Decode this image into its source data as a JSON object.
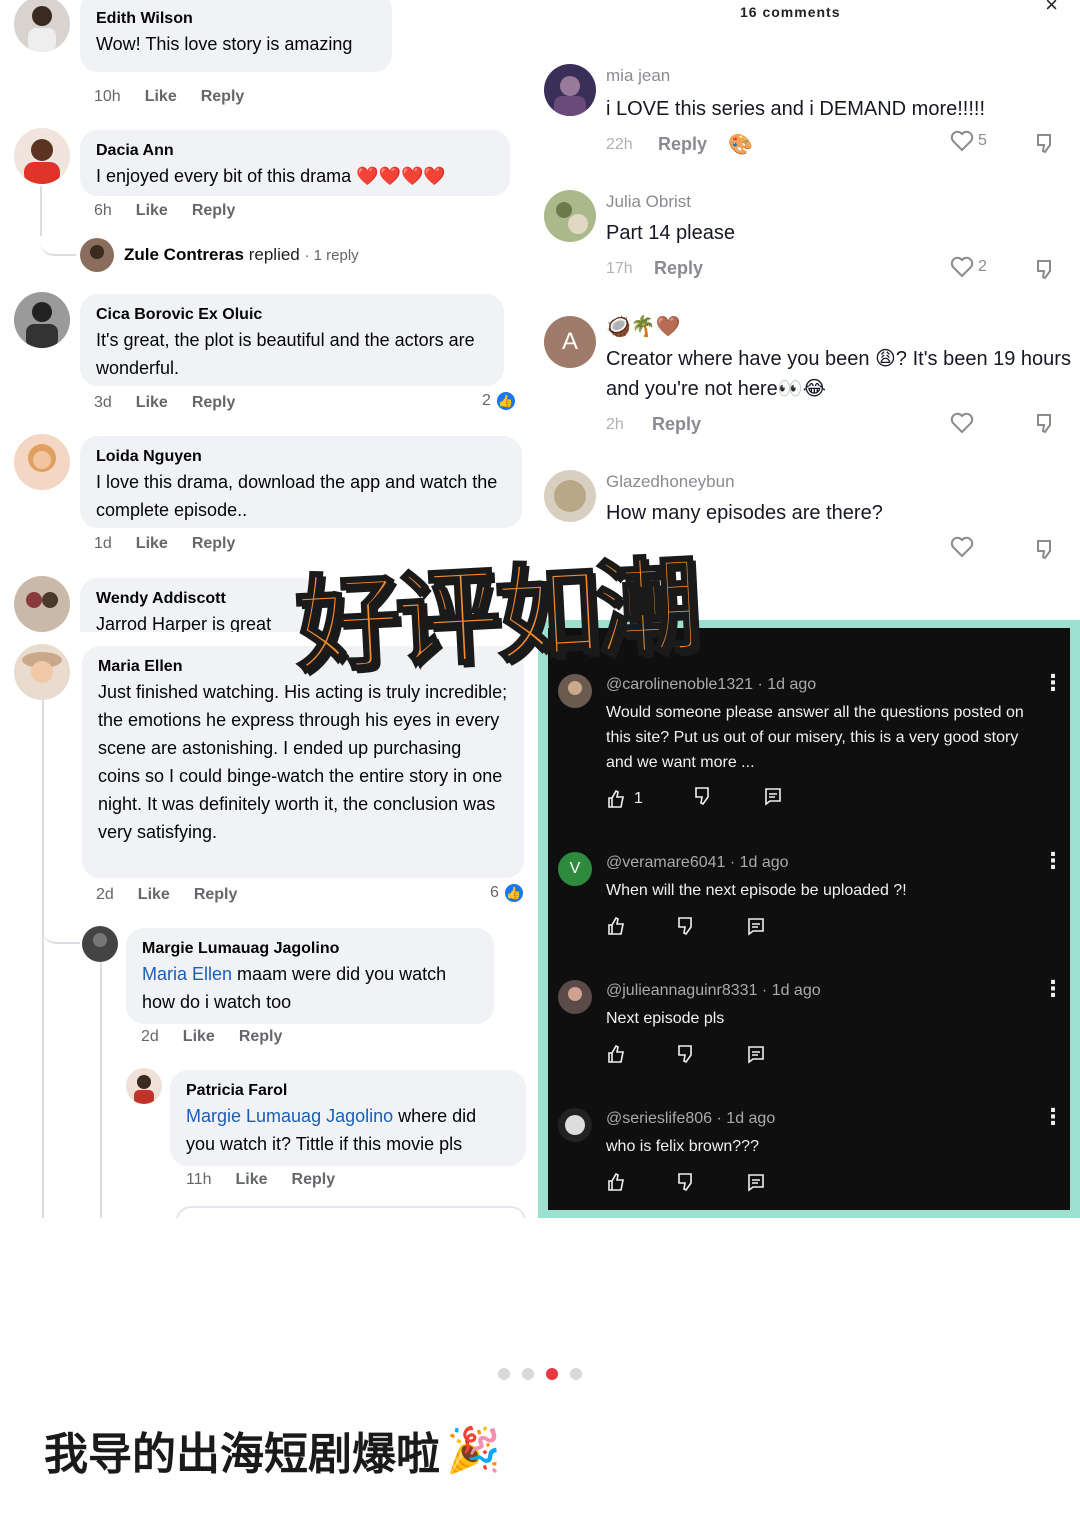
{
  "facebook": {
    "edith": {
      "name": "Edith Wilson",
      "text": "Wow! This love story is amazing",
      "time": "10h",
      "like": "Like",
      "reply": "Reply"
    },
    "dacia": {
      "name": "Dacia Ann",
      "text": "I enjoyed every bit of this drama",
      "emoji": "❤️❤️❤️❤️",
      "time": "6h",
      "like": "Like",
      "reply": "Reply",
      "replied": {
        "name": "Zule Contreras",
        "verb": "replied",
        "count": "· 1 reply"
      }
    },
    "cica": {
      "name": "Cica Borovic Ex Oluic",
      "text": "It's great, the plot is beautiful and the actors are wonderful.",
      "time": "3d",
      "like": "Like",
      "reply": "Reply",
      "reactions": "2"
    },
    "loida": {
      "name": "Loida Nguyen",
      "text": "I love this drama, download the app and watch the complete episode..",
      "time": "1d",
      "like": "Like",
      "reply": "Reply"
    },
    "wendy": {
      "name": "Wendy Addiscott",
      "text": "Jarrod Harper is great"
    },
    "maria": {
      "name": "Maria Ellen",
      "text": "Just finished watching. His acting is truly incredible; the emotions he express through his eyes in every scene are astonishing. I ended up purchasing coins so I could binge-watch the entire story in one night. It was definitely worth it, the conclusion was very satisfying.",
      "time": "2d",
      "like": "Like",
      "reply": "Reply",
      "reactions": "6"
    },
    "margie": {
      "name": "Margie Lumauag Jagolino",
      "mention": "Maria Ellen",
      "text": " maam were did you watch how do i watch too",
      "time": "2d",
      "like": "Like",
      "reply": "Reply"
    },
    "patricia": {
      "name": "Patricia Farol",
      "mention": "Margie Lumauag Jagolino",
      "text": " where did you watch it? Tittle if this movie pls",
      "time": "11h",
      "like": "Like",
      "reply": "Reply"
    }
  },
  "tiktok": {
    "header": "16 comments",
    "close": "×",
    "comments": [
      {
        "name": "mia jean",
        "text": "i LOVE this series and i DEMAND more!!!!!",
        "time": "22h",
        "reply": "Reply",
        "likes": "5",
        "extra": "🎨"
      },
      {
        "name": "Julia Obrist",
        "text": "Part 14 please",
        "time": "17h",
        "reply": "Reply",
        "likes": "2"
      },
      {
        "name": "🥥🌴🤎",
        "text": "Creator where have you been 😩? It's been 19 hours and you're not here👀😂",
        "time": "2h",
        "reply": "Reply",
        "likes": "",
        "avatar_letter": "A"
      },
      {
        "name": "Glazedhoneybun",
        "text": "How many episodes are there?",
        "time": "",
        "reply": "",
        "likes": ""
      }
    ]
  },
  "youtube": {
    "comments": [
      {
        "handle": "@carolinenoble1321 · 1d ago",
        "text": "Would someone please answer all the questions posted on this site? Put us out of our misery, this is a very good story and we want more ...",
        "likes": "1"
      },
      {
        "handle": "@veramare6041 · 1d ago",
        "text": "When will the next episode be uploaded ?!",
        "likes": "",
        "avatar_letter": "V"
      },
      {
        "handle": "@julieannaguinr8331 · 1d ago",
        "text": "Next episode pls",
        "likes": ""
      },
      {
        "handle": "@serieslife806 · 1d ago",
        "text": "who is felix brown???",
        "likes": ""
      }
    ]
  },
  "overlay_title": "好评如潮",
  "caption": {
    "text": "我导的出海短剧爆啦",
    "emoji": "🎉"
  },
  "carousel": {
    "total": 4,
    "active_index": 2
  },
  "colors": {
    "overlay_orange": "#f28a2e",
    "yt_frame": "#9ce0cf",
    "like_blue": "#1877f2",
    "active_dot": "#e8373f"
  }
}
